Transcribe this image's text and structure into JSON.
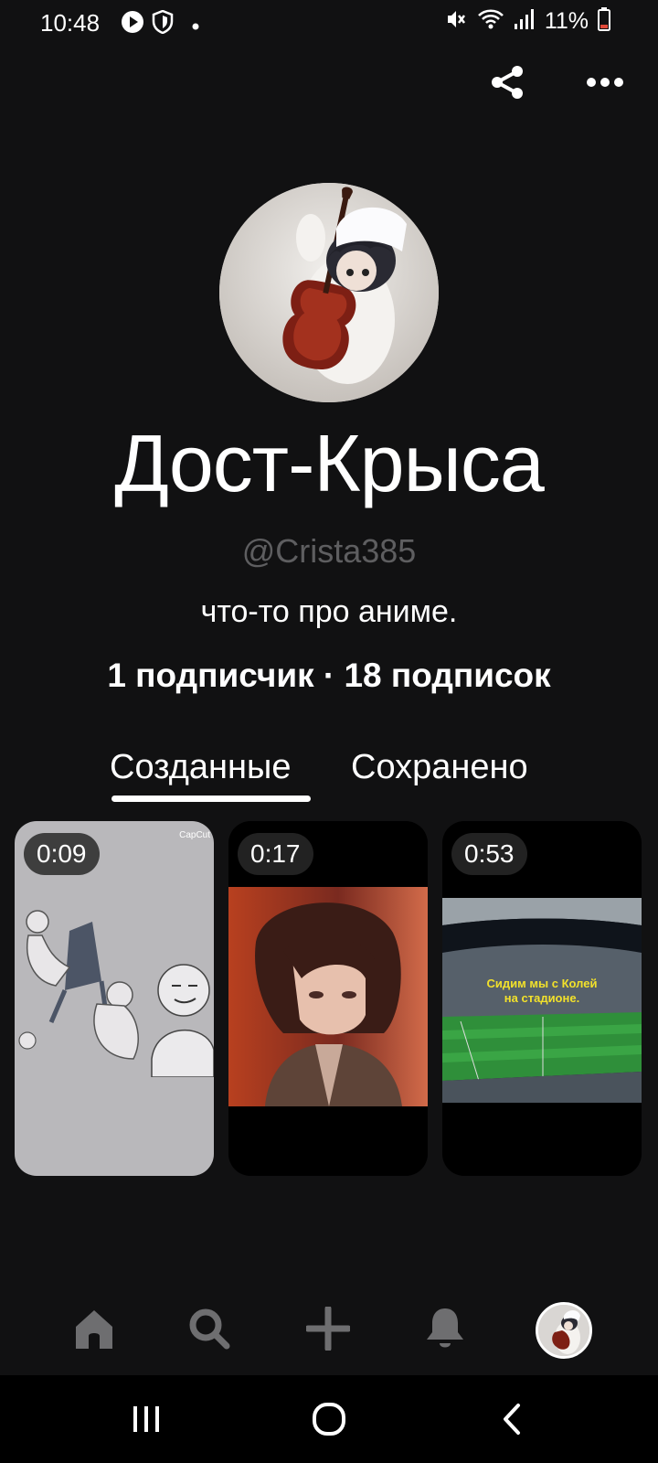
{
  "status_bar": {
    "time": "10:48",
    "battery": "11%",
    "icons": [
      "play-icon",
      "shield-icon",
      "dot-icon",
      "mute-icon",
      "wifi-icon",
      "signal-icon",
      "battery-icon"
    ]
  },
  "top_bar": {
    "icons": [
      "share-icon",
      "more-icon"
    ]
  },
  "profile": {
    "name": "Дост-Крыса",
    "handle": "@Crista385",
    "bio": "что-то про аниме.",
    "stats": "1 подписчик · 18 подписок"
  },
  "tabs": [
    {
      "label": "Созданные",
      "active": true
    },
    {
      "label": "Сохранено",
      "active": false
    }
  ],
  "pins": [
    {
      "duration": "0:09",
      "watermark": "CapCut"
    },
    {
      "duration": "0:17"
    },
    {
      "duration": "0:53",
      "caption_line1": "Сидим мы с Колей",
      "caption_line2": "на стадионе."
    }
  ],
  "bottom_nav": {
    "items": [
      "home-icon",
      "search-icon",
      "create-icon",
      "notifications-icon",
      "profile-avatar"
    ]
  },
  "system_nav": {
    "items": [
      "recent-apps-icon",
      "home-button-icon",
      "back-icon"
    ]
  },
  "colors": {
    "background": "#111112",
    "handle_text": "#5e5e60",
    "accent_text": "#ffffff",
    "battery_low": "#e04a3a"
  }
}
